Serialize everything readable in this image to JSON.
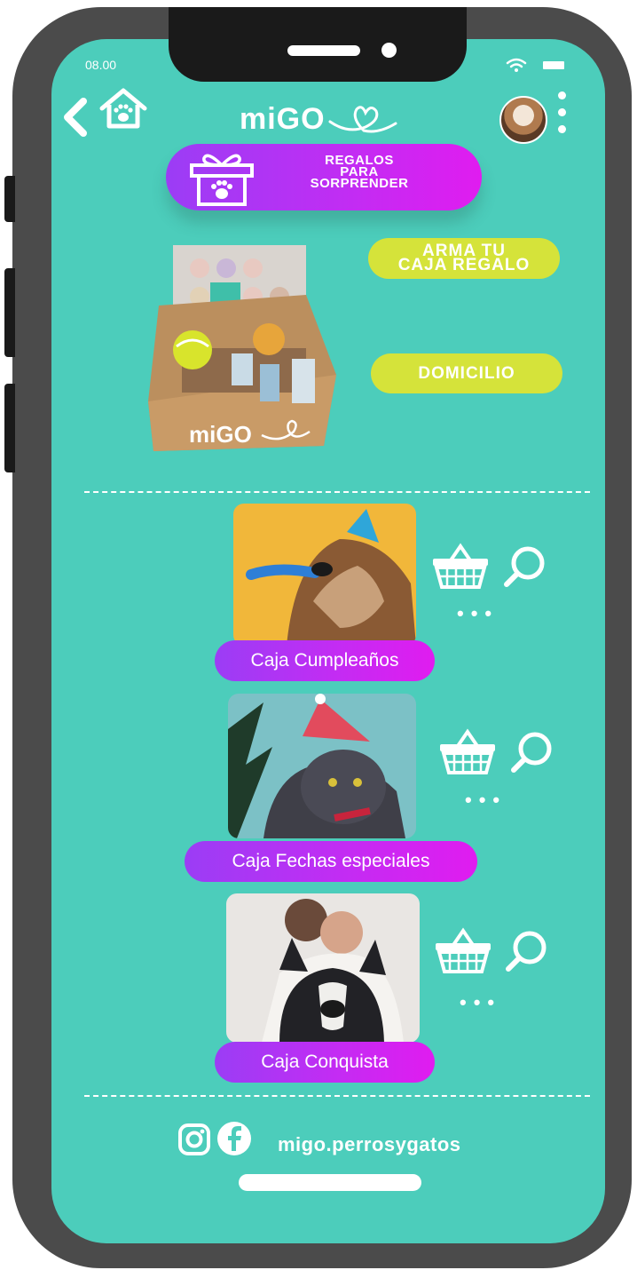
{
  "status_bar": {
    "time": "08.00"
  },
  "header": {
    "logo": "miGO"
  },
  "hero": {
    "line1": "REGALOS",
    "line2": "PARA",
    "line3": "SORPRENDER"
  },
  "gift_box": {
    "brand": "miGO"
  },
  "actions": {
    "arma_line1": "ARMA TU",
    "arma_line2": "CAJA REGALO",
    "domicilio": "DOMICILIO"
  },
  "products": [
    {
      "label": "Caja Cumpleaños",
      "more": "•••"
    },
    {
      "label": "Caja Fechas especiales",
      "more": "•••"
    },
    {
      "label": "Caja Conquista",
      "more": "•••"
    }
  ],
  "footer": {
    "handle": "migo.perrosygatos"
  },
  "colors": {
    "screen": "#4ccdbb",
    "accent_purple": "#b030f4",
    "cta_yellow": "#d5e33a"
  },
  "icons": [
    "back-chevron-icon",
    "home-paw-icon",
    "heart-icon",
    "gift-paw-icon",
    "basket-icon",
    "search-icon",
    "instagram-icon",
    "facebook-icon"
  ]
}
